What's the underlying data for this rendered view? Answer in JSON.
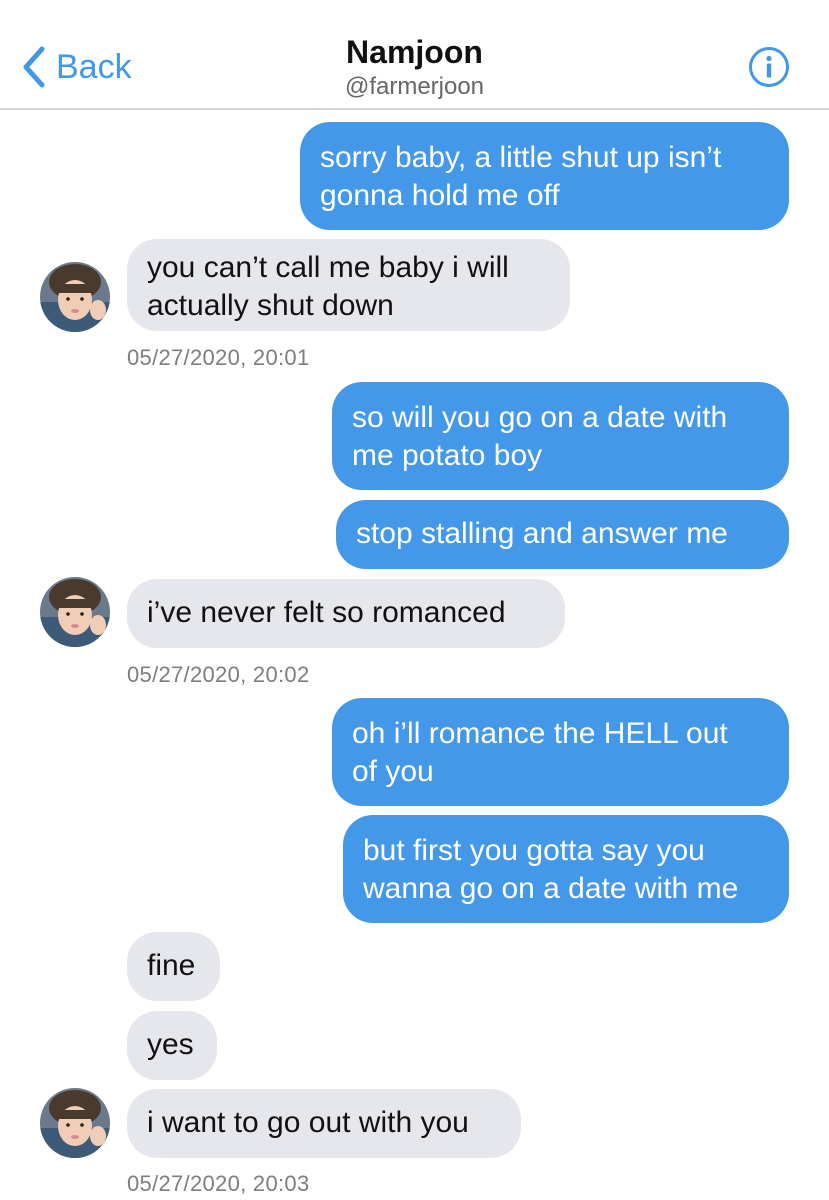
{
  "header": {
    "back_label": "Back",
    "title": "Namjoon",
    "handle": "@farmerjoon"
  },
  "colors": {
    "accent": "#3f98ea",
    "outgoing_bubble": "#4498ea",
    "incoming_bubble": "#e6e7ec"
  },
  "messages": [
    {
      "from": "me",
      "text": "sorry baby, a little shut up isn’t\ngonna hold me off"
    },
    {
      "from": "them",
      "text": "you can’t call me baby i will\nactually shut down"
    },
    {
      "from": "me",
      "text": "so will you go on a date with\nme potato boy"
    },
    {
      "from": "me",
      "text": "stop stalling and answer me"
    },
    {
      "from": "them",
      "text": "i’ve never felt so romanced"
    },
    {
      "from": "me",
      "text": "oh i’ll romance the HELL out\nof you"
    },
    {
      "from": "me",
      "text": "but first you gotta say you\nwanna go on a date with me"
    },
    {
      "from": "them",
      "text": "fine"
    },
    {
      "from": "them",
      "text": "yes"
    },
    {
      "from": "them",
      "text": "i want to go out with you"
    }
  ],
  "timestamps": [
    "05/27/2020, 20:01",
    "05/27/2020, 20:02",
    "05/27/2020, 20:03"
  ]
}
